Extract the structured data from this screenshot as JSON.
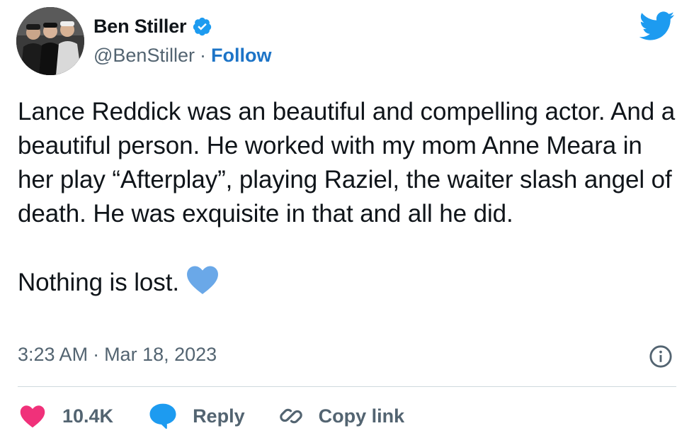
{
  "user": {
    "display_name": "Ben Stiller",
    "handle": "@BenStiller",
    "separator": "·",
    "follow_label": "Follow"
  },
  "tweet": {
    "paragraph1": "Lance Reddick was an beautiful and compelling actor. And a beautiful person. He worked with my mom Anne Meara in her play “Afterplay”, playing Raziel, the waiter slash angel of death.  He was exquisite in that and all he did.",
    "paragraph2": "Nothing is lost.",
    "emoji": "blue-heart",
    "time": "3:23 AM",
    "date": "Mar 18, 2023",
    "separator": "·"
  },
  "actions": {
    "likes": "10.4K",
    "reply_label": "Reply",
    "copy_link_label": "Copy link"
  },
  "icons": [
    "verified-badge-icon",
    "twitter-bird-icon",
    "info-icon",
    "heart-icon",
    "reply-bubble-icon",
    "link-icon"
  ],
  "colors": {
    "brand_blue": "#1d9bf0",
    "follow_link": "#1d74c7",
    "like_pink": "#f0317a",
    "blue_heart": "#6aa8e8",
    "secondary_text": "#536471"
  }
}
